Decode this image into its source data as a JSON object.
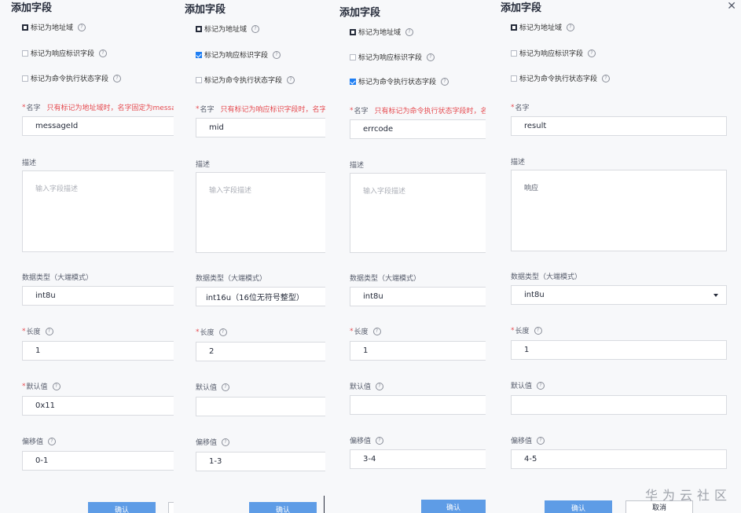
{
  "dialog_title": "添加字段",
  "options": {
    "address": "标记为地址域",
    "response": "标记为响应标识字段",
    "command": "标记为命令执行状态字段"
  },
  "labels": {
    "name": "名字",
    "description": "描述",
    "datatype": "数据类型（大端模式）",
    "length": "长度",
    "default": "默认值",
    "offset": "偏移值"
  },
  "help_glyph": "?",
  "required_star": "*",
  "description_placeholder": "输入字段描述",
  "confirm": "确认",
  "cancel": "取消",
  "watermark": "华为云社区",
  "panels": [
    {
      "checked": "address",
      "name_warning": "只有标记为地址域时，名字固定为messag",
      "name": "messageId",
      "description": "",
      "datatype": "int8u",
      "length": "1",
      "default": "0x11",
      "offset": "0-1"
    },
    {
      "checked": "response",
      "name_warning": "只有标记为响应标识字段时，名字固",
      "name": "mid",
      "description": "",
      "datatype": "int16u（16位无符号整型）",
      "length": "2",
      "default": "",
      "offset": "1-3"
    },
    {
      "checked": "command",
      "name_warning": "只有标记为命令执行状态字段时，名字",
      "name": "errcode",
      "description": "",
      "datatype": "int8u",
      "length": "1",
      "default": "",
      "offset": "3-4"
    },
    {
      "checked": "none",
      "name_warning": "",
      "name": "result",
      "description": "响应",
      "datatype": "int8u",
      "length": "1",
      "default": "",
      "offset": "4-5"
    }
  ]
}
